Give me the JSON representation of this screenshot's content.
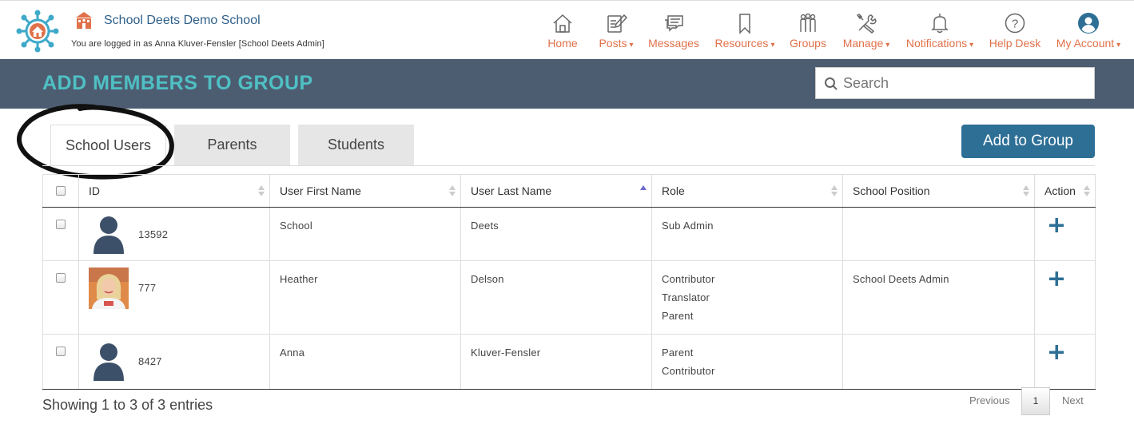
{
  "header": {
    "school_name": "School Deets Demo School",
    "logged_in_text": "You are logged in as Anna Kluver-Fensler [School Deets Admin]",
    "logo_icon": "school-deets-logo-icon",
    "school_icon": "school-building-icon",
    "accent_color": "#e0714a",
    "nav": [
      {
        "label": "Home",
        "icon": "home-icon",
        "has_caret": false
      },
      {
        "label": "Posts",
        "icon": "edit-icon",
        "has_caret": true
      },
      {
        "label": "Messages",
        "icon": "messages-icon",
        "has_caret": false
      },
      {
        "label": "Resources",
        "icon": "bookmark-icon",
        "has_caret": true
      },
      {
        "label": "Groups",
        "icon": "groups-icon",
        "has_caret": false
      },
      {
        "label": "Manage",
        "icon": "tools-icon",
        "has_caret": true
      },
      {
        "label": "Notifications",
        "icon": "bell-icon",
        "has_caret": true
      },
      {
        "label": "Help Desk",
        "icon": "help-icon",
        "has_caret": false
      },
      {
        "label": "My Account",
        "icon": "account-icon",
        "has_caret": true
      }
    ],
    "caret": "▾"
  },
  "titlebar": {
    "title": "ADD MEMBERS TO GROUP",
    "search_placeholder": "Search",
    "bg_color": "#4d5d71",
    "title_color": "#4fc0c4"
  },
  "tabs": [
    {
      "label": "School Users",
      "active": true
    },
    {
      "label": "Parents",
      "active": false
    },
    {
      "label": "Students",
      "active": false
    }
  ],
  "add_to_group_label": "Add to Group",
  "table": {
    "columns": [
      "ID",
      "User First Name",
      "User Last Name",
      "Role",
      "School Position",
      "Action"
    ],
    "sorted_column": "User Last Name",
    "rows": [
      {
        "id": "13592",
        "avatar": "default-user-icon",
        "first_name": "School",
        "last_name": "Deets",
        "roles": [
          "Sub Admin"
        ],
        "position": ""
      },
      {
        "id": "777",
        "avatar": "user-photo",
        "first_name": "Heather",
        "last_name": "Delson",
        "roles": [
          "Contributor",
          "Translator",
          "Parent"
        ],
        "position": "School Deets Admin"
      },
      {
        "id": "8427",
        "avatar": "default-user-icon",
        "first_name": "Anna",
        "last_name": "Kluver-Fensler",
        "roles": [
          "Parent",
          "Contributor"
        ],
        "position": ""
      }
    ]
  },
  "footer": {
    "entries_text": "Showing 1 to 3 of 3 entries",
    "previous_label": "Previous",
    "current_page": "1",
    "next_label": "Next"
  }
}
